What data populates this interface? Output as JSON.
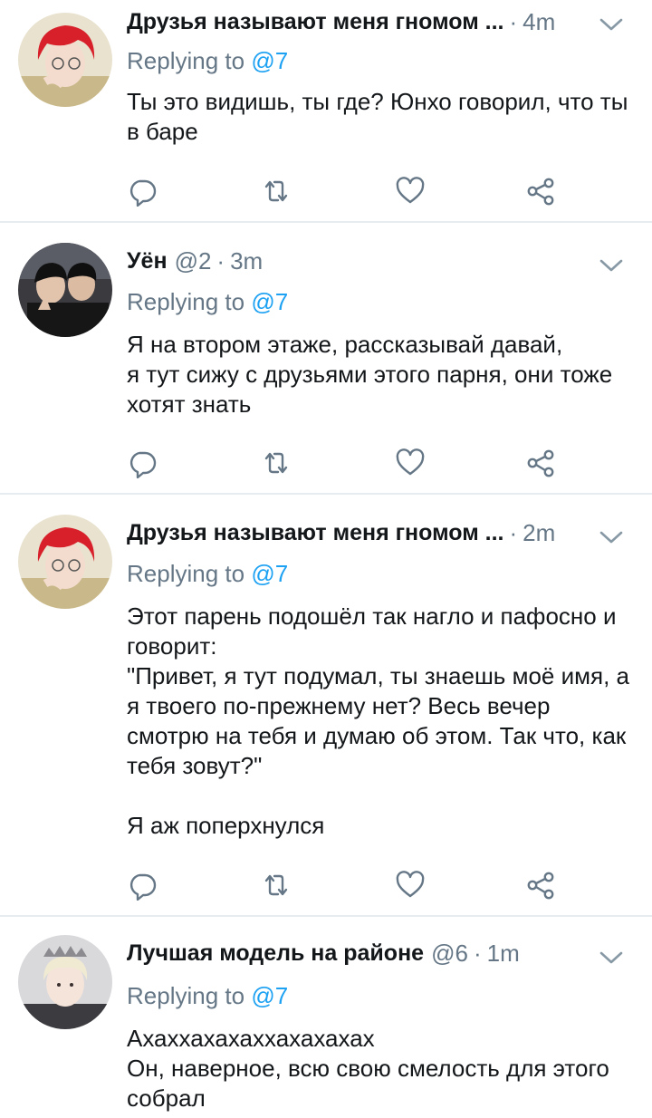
{
  "tweets": [
    {
      "display_name": "Друзья называют меня гномом ...",
      "handle": "",
      "separator": "·",
      "time": "4m",
      "replying_prefix": "Replying to",
      "replying_to": "@7",
      "text": "Ты это видишь, ты где? Юнхо говорил, что ты в баре",
      "avatar": "red-hair-avatar"
    },
    {
      "display_name": "Уён",
      "handle": "@2",
      "separator": "·",
      "time": "3m",
      "replying_prefix": "Replying to",
      "replying_to": "@7",
      "text": "Я на втором этаже, рассказывай давай,\nя тут сижу с друзьями этого парня, они тоже хотят знать",
      "avatar": "dark-duo-avatar"
    },
    {
      "display_name": "Друзья называют меня гномом ...",
      "handle": "",
      "separator": "·",
      "time": "2m",
      "replying_prefix": "Replying to",
      "replying_to": "@7",
      "text": "Этот парень подошёл так нагло и пафосно и говорит:\n\"Привет, я тут подумал, ты знаешь моё имя, а я твоего по-прежнему нет? Весь вечер смотрю на тебя и думаю об этом. Так что, как тебя зовут?\"\n\nЯ аж поперхнулся",
      "avatar": "red-hair-avatar"
    },
    {
      "display_name": "Лучшая модель на районе",
      "handle": "@6",
      "separator": "·",
      "time": "1m",
      "replying_prefix": "Replying to",
      "replying_to": "@7",
      "text": "Ахаххахахаххахахахах\nОн, наверное, всю свою смелость для этого собрал",
      "avatar": "blond-crown-avatar"
    }
  ],
  "icons": {
    "reply": "reply-icon",
    "retweet": "retweet-icon",
    "like": "heart-icon",
    "share": "share-icon",
    "menu": "chevron-down-icon"
  },
  "colors": {
    "text": "#14171a",
    "secondary": "#657786",
    "mention": "#1da1f2",
    "divider": "#e6ecf0"
  }
}
